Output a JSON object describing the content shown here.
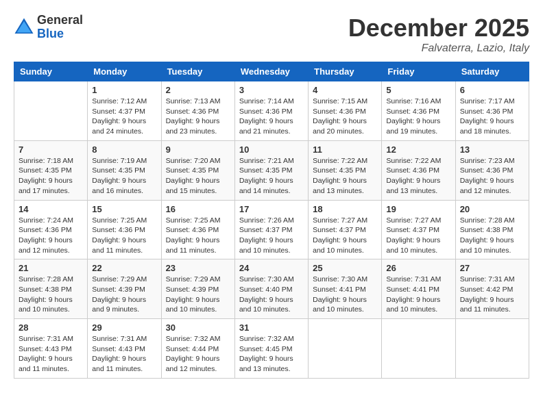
{
  "logo": {
    "general": "General",
    "blue": "Blue"
  },
  "title": "December 2025",
  "location": "Falvaterra, Lazio, Italy",
  "days_of_week": [
    "Sunday",
    "Monday",
    "Tuesday",
    "Wednesday",
    "Thursday",
    "Friday",
    "Saturday"
  ],
  "weeks": [
    [
      {
        "day": "",
        "empty": true
      },
      {
        "day": "1",
        "sunrise": "Sunrise: 7:12 AM",
        "sunset": "Sunset: 4:37 PM",
        "daylight": "Daylight: 9 hours and 24 minutes."
      },
      {
        "day": "2",
        "sunrise": "Sunrise: 7:13 AM",
        "sunset": "Sunset: 4:36 PM",
        "daylight": "Daylight: 9 hours and 23 minutes."
      },
      {
        "day": "3",
        "sunrise": "Sunrise: 7:14 AM",
        "sunset": "Sunset: 4:36 PM",
        "daylight": "Daylight: 9 hours and 21 minutes."
      },
      {
        "day": "4",
        "sunrise": "Sunrise: 7:15 AM",
        "sunset": "Sunset: 4:36 PM",
        "daylight": "Daylight: 9 hours and 20 minutes."
      },
      {
        "day": "5",
        "sunrise": "Sunrise: 7:16 AM",
        "sunset": "Sunset: 4:36 PM",
        "daylight": "Daylight: 9 hours and 19 minutes."
      },
      {
        "day": "6",
        "sunrise": "Sunrise: 7:17 AM",
        "sunset": "Sunset: 4:36 PM",
        "daylight": "Daylight: 9 hours and 18 minutes."
      }
    ],
    [
      {
        "day": "7",
        "sunrise": "Sunrise: 7:18 AM",
        "sunset": "Sunset: 4:35 PM",
        "daylight": "Daylight: 9 hours and 17 minutes."
      },
      {
        "day": "8",
        "sunrise": "Sunrise: 7:19 AM",
        "sunset": "Sunset: 4:35 PM",
        "daylight": "Daylight: 9 hours and 16 minutes."
      },
      {
        "day": "9",
        "sunrise": "Sunrise: 7:20 AM",
        "sunset": "Sunset: 4:35 PM",
        "daylight": "Daylight: 9 hours and 15 minutes."
      },
      {
        "day": "10",
        "sunrise": "Sunrise: 7:21 AM",
        "sunset": "Sunset: 4:35 PM",
        "daylight": "Daylight: 9 hours and 14 minutes."
      },
      {
        "day": "11",
        "sunrise": "Sunrise: 7:22 AM",
        "sunset": "Sunset: 4:35 PM",
        "daylight": "Daylight: 9 hours and 13 minutes."
      },
      {
        "day": "12",
        "sunrise": "Sunrise: 7:22 AM",
        "sunset": "Sunset: 4:36 PM",
        "daylight": "Daylight: 9 hours and 13 minutes."
      },
      {
        "day": "13",
        "sunrise": "Sunrise: 7:23 AM",
        "sunset": "Sunset: 4:36 PM",
        "daylight": "Daylight: 9 hours and 12 minutes."
      }
    ],
    [
      {
        "day": "14",
        "sunrise": "Sunrise: 7:24 AM",
        "sunset": "Sunset: 4:36 PM",
        "daylight": "Daylight: 9 hours and 12 minutes."
      },
      {
        "day": "15",
        "sunrise": "Sunrise: 7:25 AM",
        "sunset": "Sunset: 4:36 PM",
        "daylight": "Daylight: 9 hours and 11 minutes."
      },
      {
        "day": "16",
        "sunrise": "Sunrise: 7:25 AM",
        "sunset": "Sunset: 4:36 PM",
        "daylight": "Daylight: 9 hours and 11 minutes."
      },
      {
        "day": "17",
        "sunrise": "Sunrise: 7:26 AM",
        "sunset": "Sunset: 4:37 PM",
        "daylight": "Daylight: 9 hours and 10 minutes."
      },
      {
        "day": "18",
        "sunrise": "Sunrise: 7:27 AM",
        "sunset": "Sunset: 4:37 PM",
        "daylight": "Daylight: 9 hours and 10 minutes."
      },
      {
        "day": "19",
        "sunrise": "Sunrise: 7:27 AM",
        "sunset": "Sunset: 4:37 PM",
        "daylight": "Daylight: 9 hours and 10 minutes."
      },
      {
        "day": "20",
        "sunrise": "Sunrise: 7:28 AM",
        "sunset": "Sunset: 4:38 PM",
        "daylight": "Daylight: 9 hours and 10 minutes."
      }
    ],
    [
      {
        "day": "21",
        "sunrise": "Sunrise: 7:28 AM",
        "sunset": "Sunset: 4:38 PM",
        "daylight": "Daylight: 9 hours and 10 minutes."
      },
      {
        "day": "22",
        "sunrise": "Sunrise: 7:29 AM",
        "sunset": "Sunset: 4:39 PM",
        "daylight": "Daylight: 9 hours and 9 minutes."
      },
      {
        "day": "23",
        "sunrise": "Sunrise: 7:29 AM",
        "sunset": "Sunset: 4:39 PM",
        "daylight": "Daylight: 9 hours and 10 minutes."
      },
      {
        "day": "24",
        "sunrise": "Sunrise: 7:30 AM",
        "sunset": "Sunset: 4:40 PM",
        "daylight": "Daylight: 9 hours and 10 minutes."
      },
      {
        "day": "25",
        "sunrise": "Sunrise: 7:30 AM",
        "sunset": "Sunset: 4:41 PM",
        "daylight": "Daylight: 9 hours and 10 minutes."
      },
      {
        "day": "26",
        "sunrise": "Sunrise: 7:31 AM",
        "sunset": "Sunset: 4:41 PM",
        "daylight": "Daylight: 9 hours and 10 minutes."
      },
      {
        "day": "27",
        "sunrise": "Sunrise: 7:31 AM",
        "sunset": "Sunset: 4:42 PM",
        "daylight": "Daylight: 9 hours and 11 minutes."
      }
    ],
    [
      {
        "day": "28",
        "sunrise": "Sunrise: 7:31 AM",
        "sunset": "Sunset: 4:43 PM",
        "daylight": "Daylight: 9 hours and 11 minutes."
      },
      {
        "day": "29",
        "sunrise": "Sunrise: 7:31 AM",
        "sunset": "Sunset: 4:43 PM",
        "daylight": "Daylight: 9 hours and 11 minutes."
      },
      {
        "day": "30",
        "sunrise": "Sunrise: 7:32 AM",
        "sunset": "Sunset: 4:44 PM",
        "daylight": "Daylight: 9 hours and 12 minutes."
      },
      {
        "day": "31",
        "sunrise": "Sunrise: 7:32 AM",
        "sunset": "Sunset: 4:45 PM",
        "daylight": "Daylight: 9 hours and 13 minutes."
      },
      {
        "day": "",
        "empty": true
      },
      {
        "day": "",
        "empty": true
      },
      {
        "day": "",
        "empty": true
      }
    ]
  ]
}
